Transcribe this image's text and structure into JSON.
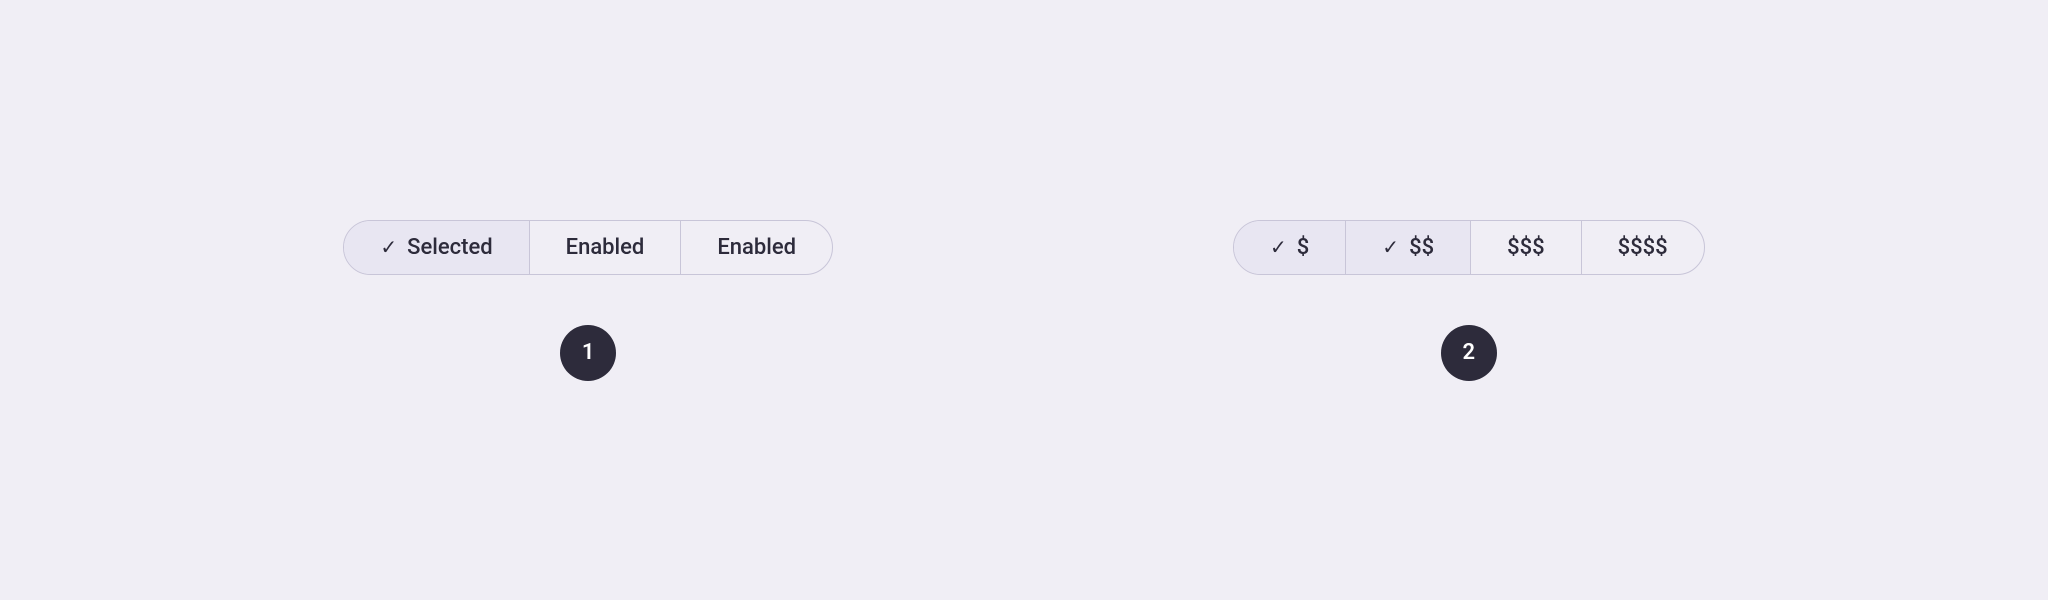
{
  "section1": {
    "segments": [
      {
        "id": "s1-selected",
        "label": "Selected",
        "hasCheck": true,
        "state": "selected"
      },
      {
        "id": "s1-enabled1",
        "label": "Enabled",
        "hasCheck": false,
        "state": "enabled"
      },
      {
        "id": "s1-enabled2",
        "label": "Enabled",
        "hasCheck": false,
        "state": "enabled"
      }
    ],
    "badge": "1"
  },
  "section2": {
    "segments": [
      {
        "id": "s2-dollar1",
        "label": "$",
        "hasCheck": true,
        "state": "selected"
      },
      {
        "id": "s2-dollar2",
        "label": "$$",
        "hasCheck": true,
        "state": "selected-secondary"
      },
      {
        "id": "s2-dollar3",
        "label": "$$$",
        "hasCheck": false,
        "state": "enabled"
      },
      {
        "id": "s2-dollar4",
        "label": "$$$$",
        "hasCheck": false,
        "state": "enabled"
      }
    ],
    "badge": "2"
  },
  "colors": {
    "selected_bg": "#e8e6f2",
    "border": "#c8c5d8",
    "badge_bg": "#2d2b3b",
    "text": "#2d2b3b"
  }
}
